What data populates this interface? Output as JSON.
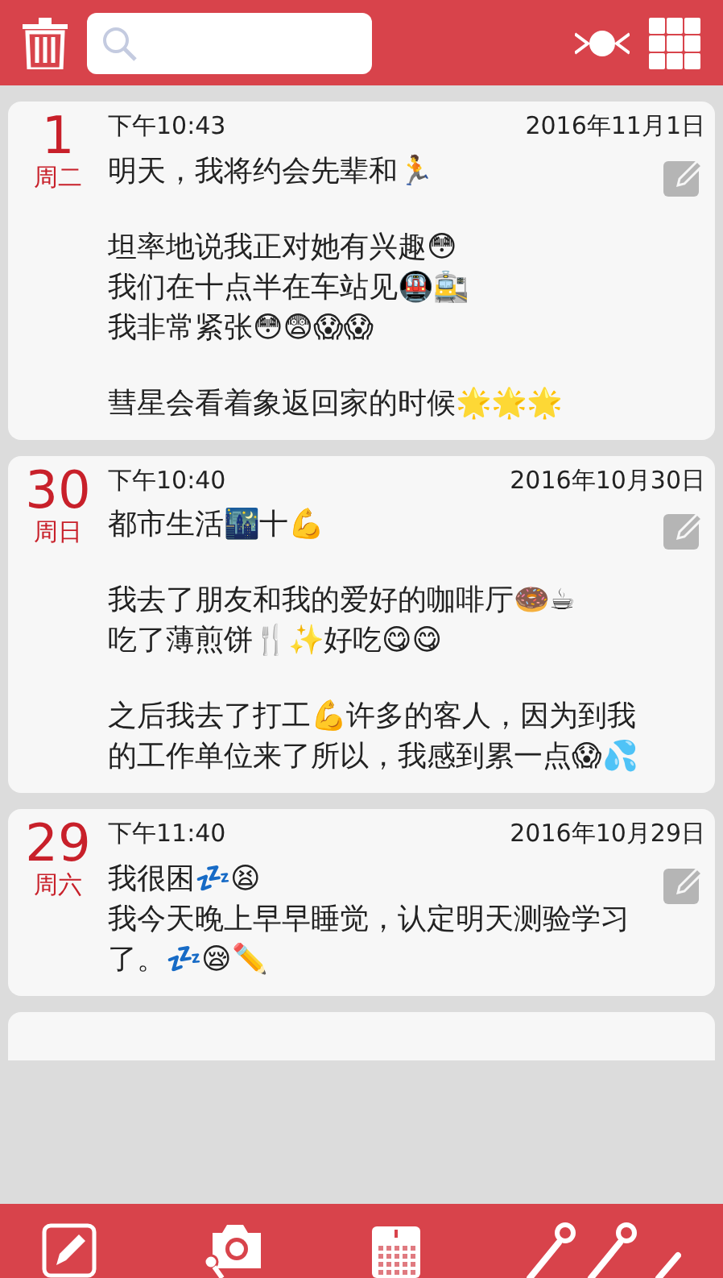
{
  "entries": [
    {
      "day": "1",
      "weekday": "周二",
      "time": "下午10:43",
      "date": "2016年11月1日",
      "paragraphs": [
        [
          "明天，我将约会先辈和🏃"
        ],
        [
          "坦率地说我正对她有兴趣😳",
          "我们在十点半在车站见🚇🚉",
          "我非常紧张😳😨😱😱"
        ],
        [
          "彗星会看着象返回家的时候🌟🌟🌟"
        ]
      ]
    },
    {
      "day": "30",
      "weekday": "周日",
      "time": "下午10:40",
      "date": "2016年10月30日",
      "paragraphs": [
        [
          "都市生活🌃十💪"
        ],
        [
          "我去了朋友和我的爱好的咖啡厅🍩☕",
          "吃了薄煎饼🍴✨好吃😋😋"
        ],
        [
          "之后我去了打工💪许多的客人，因为到我的工作单位来了所以，我感到累一点😱💦"
        ]
      ]
    },
    {
      "day": "29",
      "weekday": "周六",
      "time": "下午11:40",
      "date": "2016年10月29日",
      "paragraphs": [
        [
          "我很困💤😫",
          "我今天晚上早早睡觉，认定明天测验学习了。💤😪✏️"
        ]
      ]
    }
  ]
}
